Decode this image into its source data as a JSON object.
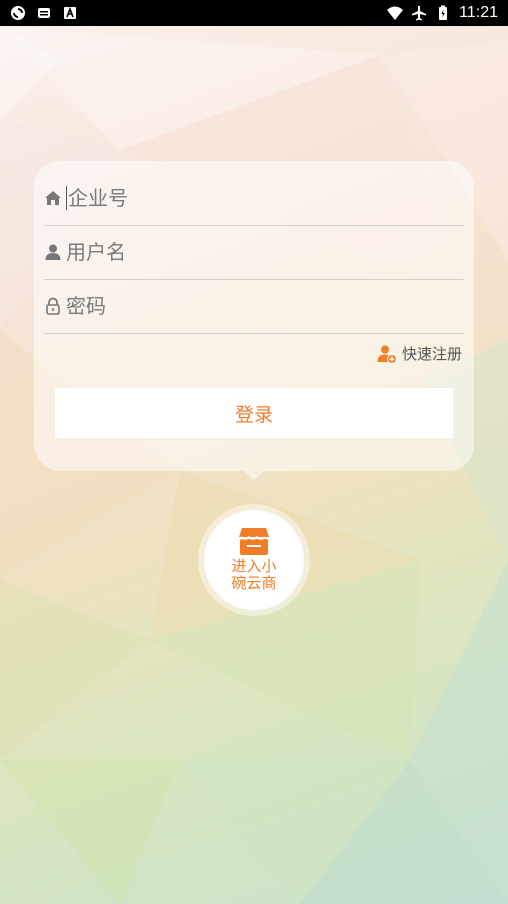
{
  "status_bar": {
    "time": "11:21",
    "icons": [
      "sync-icon",
      "message-icon",
      "a-icon",
      "wifi-icon",
      "airplane-icon",
      "battery-icon"
    ]
  },
  "login": {
    "company_placeholder": "企业号",
    "username_placeholder": "用户名",
    "password_placeholder": "密码",
    "quick_register": "快速注册",
    "login_button": "登录"
  },
  "store_button": {
    "label": "进入小碗云商"
  },
  "colors": {
    "accent": "#f07d27",
    "icon_gray": "#777777"
  }
}
